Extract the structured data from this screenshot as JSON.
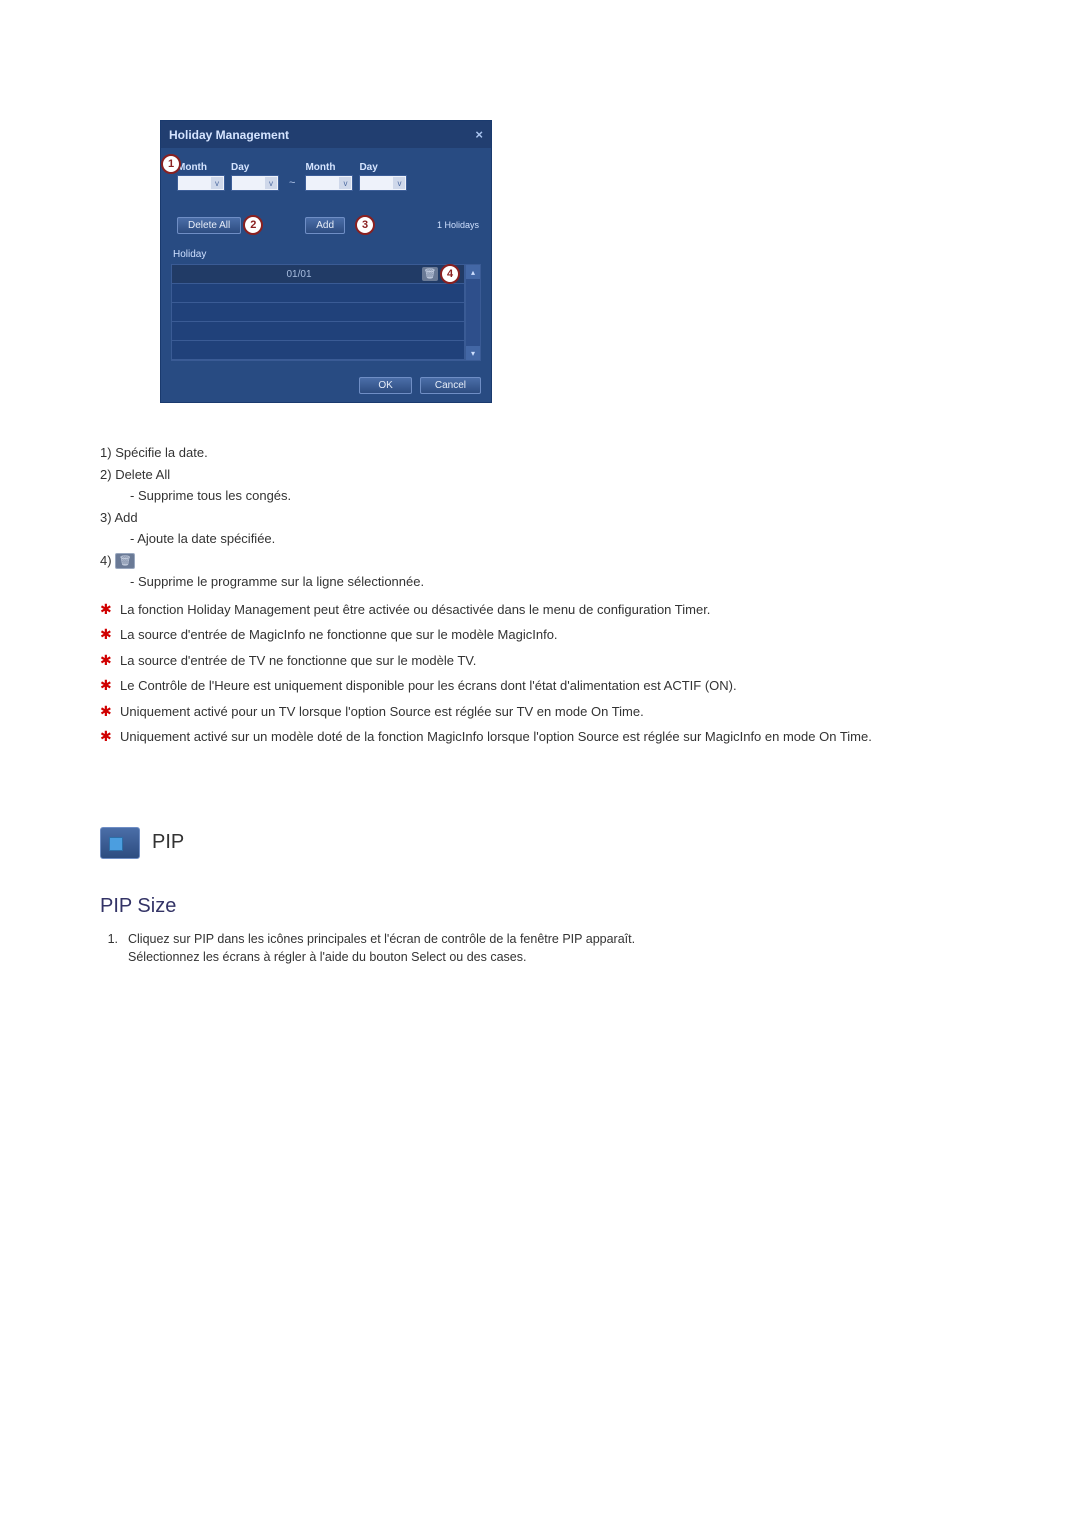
{
  "dialog": {
    "title": "Holiday Management",
    "labels": {
      "month1": "Month",
      "day1": "Day",
      "month2": "Month",
      "day2": "Day"
    },
    "buttons": {
      "delete_all": "Delete All",
      "add": "Add",
      "ok": "OK",
      "cancel": "Cancel"
    },
    "count_label": "1 Holidays",
    "list_header": "Holiday",
    "rows": [
      "01/01",
      "",
      "",
      "",
      ""
    ],
    "callouts": {
      "c1": "1",
      "c2": "2",
      "c3": "3",
      "c4": "4"
    }
  },
  "desc": {
    "l1_num": "1)",
    "l1_text": "Spécifie la date.",
    "l2_num": "2)",
    "l2_text": "Delete All",
    "l2_sub": "- Supprime tous les congés.",
    "l3_num": "3)",
    "l3_text": "Add",
    "l3_sub": "- Ajoute la date spécifiée.",
    "l4_num": "4)",
    "l4_sub": "- Supprime le programme sur la ligne sélectionnée.",
    "stars": [
      "La fonction Holiday Management peut être activée ou désactivée dans le menu de configuration Timer.",
      "La source d'entrée de MagicInfo ne fonctionne que sur le modèle MagicInfo.",
      "La source d'entrée de TV ne fonctionne que sur le modèle TV.",
      "Le Contrôle de l'Heure est uniquement disponible pour les écrans dont l'état d'alimentation est ACTIF (ON).",
      "Uniquement activé pour un TV lorsque l'option Source est réglée sur TV en mode On Time.",
      "Uniquement activé sur un modèle doté de la fonction MagicInfo lorsque l'option Source est réglée sur MagicInfo en mode On Time."
    ]
  },
  "pip": {
    "title": "PIP",
    "subtitle": "PIP Size",
    "step_num": "1.",
    "step_text1": "Cliquez sur PIP dans les icônes principales et l'écran de contrôle de la fenêtre PIP apparaît.",
    "step_text2": "Sélectionnez les écrans à régler à l'aide du bouton Select ou des cases."
  }
}
